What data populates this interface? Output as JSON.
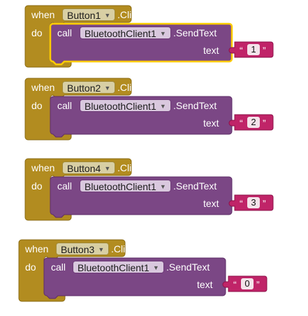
{
  "colors": {
    "event_block": "#b28c20",
    "event_border": "#8a6a10",
    "call_block": "#7b4785",
    "call_border": "#5e2d67",
    "text_block": "#c02468",
    "text_border": "#8c1049",
    "selected_outline": "#ffcc00"
  },
  "blocks": [
    {
      "when": "when",
      "do": "do",
      "component": "Button1",
      "event": ".Click",
      "call": "call",
      "client": "BluetoothClient1",
      "method": ".SendText",
      "param": "text",
      "open_quote": "“",
      "value": "1",
      "close_quote": "”",
      "selected": true
    },
    {
      "when": "when",
      "do": "do",
      "component": "Button2",
      "event": ".Click",
      "call": "call",
      "client": "BluetoothClient1",
      "method": ".SendText",
      "param": "text",
      "open_quote": "“",
      "value": "2",
      "close_quote": "”",
      "selected": false
    },
    {
      "when": "when",
      "do": "do",
      "component": "Button4",
      "event": ".Click",
      "call": "call",
      "client": "BluetoothClient1",
      "method": ".SendText",
      "param": "text",
      "open_quote": "“",
      "value": "3",
      "close_quote": "”",
      "selected": false
    },
    {
      "when": "when",
      "do": "do",
      "component": "Button3",
      "event": ".Click",
      "call": "call",
      "client": "BluetoothClient1",
      "method": ".SendText",
      "param": "text",
      "open_quote": "“",
      "value": "0",
      "close_quote": "”",
      "selected": false
    }
  ]
}
